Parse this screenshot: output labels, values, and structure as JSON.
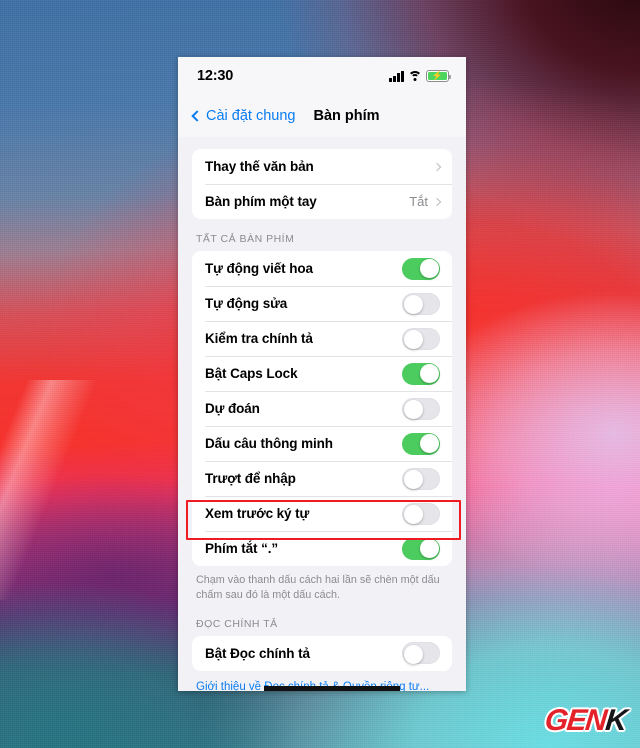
{
  "status_bar": {
    "time": "12:30",
    "signal_icon": "cellular-bars-icon",
    "wifi_icon": "wifi-icon",
    "battery_icon": "battery-charging-icon",
    "battery_color": "#4cd55f"
  },
  "nav": {
    "back_label": "Cài đặt chung",
    "back_icon": "chevron-left-icon",
    "title": "Bàn phím",
    "tint_color": "#0a7cf0"
  },
  "groups": {
    "top": {
      "rows": [
        {
          "label": "Thay thế văn bản",
          "value": "",
          "accessory": "chevron"
        },
        {
          "label": "Bàn phím một tay",
          "value": "Tắt",
          "accessory": "chevron"
        }
      ]
    },
    "all_keyboards": {
      "header": "TẤT CẢ BÀN PHÍM",
      "rows": [
        {
          "label": "Tự động viết hoa",
          "state": "on"
        },
        {
          "label": "Tự động sửa",
          "state": "off"
        },
        {
          "label": "Kiểm tra chính tả",
          "state": "off"
        },
        {
          "label": "Bật Caps Lock",
          "state": "on"
        },
        {
          "label": "Dự đoán",
          "state": "off"
        },
        {
          "label": "Dấu câu thông minh",
          "state": "on"
        },
        {
          "label": "Trượt để nhập",
          "state": "off"
        },
        {
          "label": "Xem trước ký tự",
          "state": "off",
          "highlighted": true
        },
        {
          "label": "Phím tắt “.”",
          "state": "on"
        }
      ],
      "footnote": "Chạm vào thanh dấu cách hai lần sẽ chèn một dấu chấm sau đó là một dấu cách."
    },
    "dictation": {
      "header": "ĐỌC CHÍNH TẢ",
      "rows": [
        {
          "label": "Bật Đọc chính tả",
          "state": "off"
        }
      ],
      "link": "Giới thiệu về Đọc chính tả & Quyền riêng tư..."
    }
  },
  "annotation": {
    "highlight_color": "#ee1c22",
    "highlight_target": "Xem trước ký tự"
  },
  "watermark": {
    "text_primary": "GEN",
    "text_secondary": "K",
    "primary_color": "#e3222a",
    "secondary_color": "#16161a"
  }
}
